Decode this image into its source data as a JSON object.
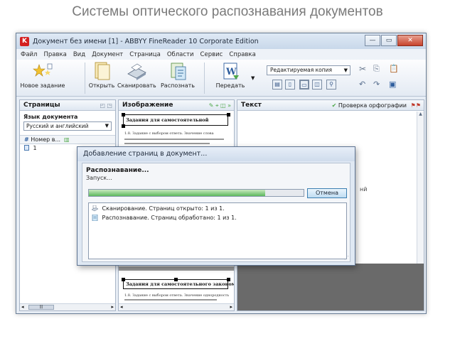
{
  "slide": {
    "title": "Системы оптического распознавания документов"
  },
  "window": {
    "title": "Документ без имени [1] - ABBYY FineReader 10 Corporate Edition",
    "app_icon_letter": "K",
    "controls": {
      "minimize": "—",
      "maximize": "▭",
      "close": "✕"
    }
  },
  "menu": [
    "Файл",
    "Правка",
    "Вид",
    "Документ",
    "Страница",
    "Области",
    "Сервис",
    "Справка"
  ],
  "toolbar": {
    "new_task": "Новое задание",
    "open": "Открыть",
    "scan": "Сканировать",
    "recognize": "Распознать",
    "transfer": "Передать",
    "format_select": "Редактируемая копия"
  },
  "pages_panel": {
    "title": "Страницы",
    "language_label": "Язык документа",
    "language_value": "Русский и английский",
    "column_header": "Номер в...",
    "rows": [
      "1"
    ],
    "scroll_thumb": "|||"
  },
  "image_panel": {
    "title": "Изображение",
    "caption_top": "Задания для самостоятельной",
    "text_line1": "1.8. Задание с выбором ответа. Значение слова",
    "caption_bottom": "Задания для самостоятельного закономерности",
    "text_line2": "1.8. Задание с выбором ответа. Значение однородность"
  },
  "text_panel": {
    "title": "Текст",
    "spell_check": "Проверка орфографии"
  },
  "dialog": {
    "title": "Добавление страниц в документ...",
    "heading": "Распознавание...",
    "status": "Запуск...",
    "progress": 0.82,
    "cancel": "Отмена",
    "log": [
      "Сканирование. Страниц открыто: 1 из 1.",
      "Распознавание. Страниц обработано: 1 из 1."
    ]
  },
  "side_fragment": "нй",
  "colors": {
    "accent": "#3c7fb1",
    "progress": "#5cb85c",
    "app_icon": "#d42020"
  }
}
